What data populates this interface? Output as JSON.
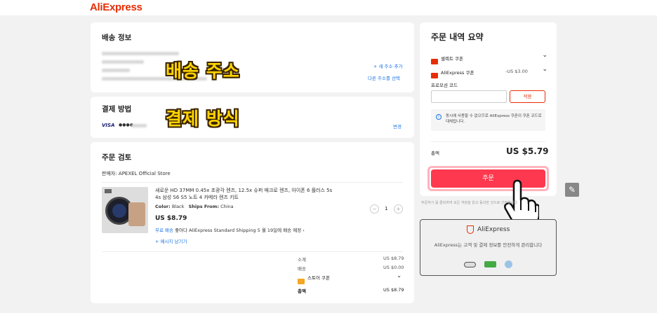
{
  "header": {
    "logo": "AliExpress"
  },
  "shipping": {
    "title": "배송 정보",
    "add_address": "+ 새 주소 추가",
    "select_other": "다른 주소를 선택",
    "overlay": "배송 주소"
  },
  "payment": {
    "title": "결제 방법",
    "card_brand": "VISA",
    "card_dots": "●●●●",
    "change": "변경",
    "overlay": "결제 방식"
  },
  "review": {
    "title": "주문 검토",
    "seller": "판매자: APEXEL Official Store",
    "product": {
      "name": "새로운 HD 37MM 0.45x 초광각 렌즈, 12.5x 슈퍼 매크로 렌즈, 아이폰 6 플러스 5s 4s 삼성 S6 S5 노트 4 카메라 렌즈 키트",
      "color_label": "Color:",
      "color_value": "Black",
      "ships_label": "Ships From:",
      "ships_value": "China",
      "price": "US $8.79",
      "shipping_free": "무료 배송",
      "shipping_text": "좋아다 AliExpress Standard Shipping 5 월 19일에 배송 예정",
      "message_link": "+ 메시지 남기기",
      "qty": "1",
      "minus": "−",
      "plus": "+"
    },
    "summary": {
      "subtotal_label": "소계",
      "subtotal_value": "US $8.79",
      "shipping_label": "배송",
      "shipping_value": "US $0.00",
      "store_coupon_label": "스토어 쿠폰",
      "total_label": "총액",
      "total_value": "US $8.79"
    }
  },
  "order_summary": {
    "title": "주문 내역 요약",
    "select_coupon": "셀렉트 쿠폰",
    "ae_coupon": "AliExpress 쿠폰",
    "ae_coupon_value": "-US $3.00",
    "promo_label": "프로모션 코드",
    "promo_placeholder": "",
    "apply": "적용",
    "notice": "동시에 사용할 수 없으므로 AliExpress 쿠폰이 쿠폰 코드로 대체됩니다.",
    "total_label": "총액",
    "total_value": "US $5.79",
    "order_button": "주문",
    "terms": "주문하기 를 클릭하여 모든 약관을 읽고 동의한 것으로 간주합니다"
  },
  "trust": {
    "brand": "AliExpress",
    "text": "AliExpress는 고객 및 결제 정보를 안전하게 관리합니다"
  },
  "colors": {
    "brand": "#e62e04",
    "order": "#fd384f",
    "link": "#1a73e8"
  }
}
